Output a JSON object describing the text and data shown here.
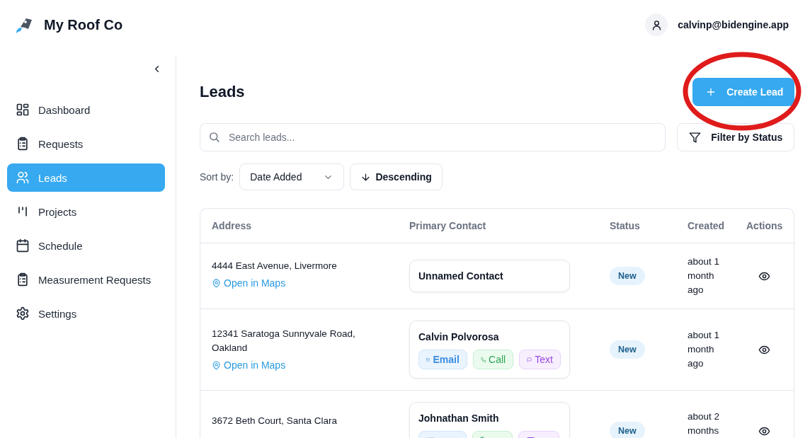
{
  "brand": {
    "name": "My Roof Co"
  },
  "user": {
    "email": "calvinp@bidengine.app"
  },
  "sidebar": {
    "items": [
      {
        "label": "Dashboard",
        "selected": false
      },
      {
        "label": "Requests",
        "selected": false
      },
      {
        "label": "Leads",
        "selected": true
      },
      {
        "label": "Projects",
        "selected": false
      },
      {
        "label": "Schedule",
        "selected": false
      },
      {
        "label": "Measurement Requests",
        "selected": false
      },
      {
        "label": "Settings",
        "selected": false
      }
    ]
  },
  "page": {
    "title": "Leads",
    "create_button": "Create Lead"
  },
  "search": {
    "placeholder": "Search leads..."
  },
  "filter_button": "Filter by Status",
  "sort": {
    "label": "Sort by:",
    "value": "Date Added",
    "order": "Descending"
  },
  "table": {
    "columns": [
      "Address",
      "Primary Contact",
      "Status",
      "Created",
      "Actions"
    ],
    "rows": [
      {
        "address": "4444 East Avenue, Livermore",
        "maps_link": "Open in Maps",
        "contact": {
          "name": "Unnamed Contact"
        },
        "status": "New",
        "created": "about 1 month ago"
      },
      {
        "address": "12341 Saratoga Sunnyvale Road, Oakland",
        "maps_link": "Open in Maps",
        "contact": {
          "name": "Calvin Polvorosa",
          "actions": [
            {
              "kind": "email",
              "label": "Email"
            },
            {
              "kind": "call",
              "label": "Call"
            },
            {
              "kind": "text",
              "label": "Text"
            }
          ]
        },
        "status": "New",
        "created": "about 1 month ago"
      },
      {
        "address": "3672 Beth Court, Santa Clara",
        "contact": {
          "name": "Johnathan Smith",
          "actions": [
            {
              "kind": "email"
            },
            {
              "kind": "call"
            },
            {
              "kind": "text"
            }
          ]
        },
        "status": "New",
        "created": "about 2 months"
      }
    ]
  }
}
